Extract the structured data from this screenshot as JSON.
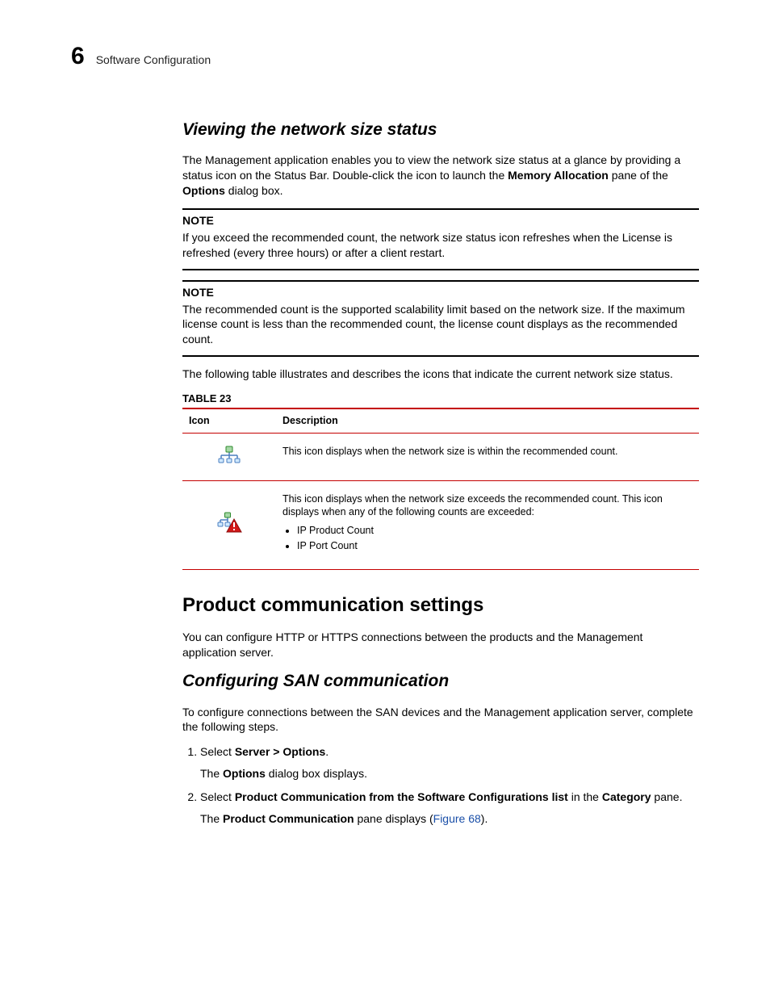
{
  "header": {
    "chapter_num": "6",
    "chapter_title": "Software Configuration"
  },
  "s1": {
    "heading": "Viewing the network size status",
    "para1_a": "The Management application enables you to view the network size status at a glance by providing a status icon on the Status Bar. Double-click the icon to launch the ",
    "para1_b": "Memory Allocation",
    "para1_c": " pane of the ",
    "para1_d": "Options",
    "para1_e": " dialog box.",
    "note1_label": "NOTE",
    "note1_body": "If you exceed the recommended count, the network size status icon refreshes when the License is refreshed (every three hours) or after a client restart.",
    "note2_label": "NOTE",
    "note2_body": "The recommended count is the supported scalability limit based on the network size. If the maximum license count is less than the recommended count, the license count displays as the recommended count.",
    "after_notes": "The following table illustrates and describes the icons that indicate the current network size status.",
    "table_label": "TABLE 23",
    "th_icon": "Icon",
    "th_desc": "Description",
    "row1_desc": "This icon displays when the network size is within the recommended count.",
    "row2_desc": "This icon displays when the network size exceeds the recommended count. This icon displays when any of the following counts are exceeded:",
    "row2_li1": "IP Product Count",
    "row2_li2": "IP Port Count"
  },
  "s2": {
    "heading": "Product communication settings",
    "intro": "You can configure HTTP or HTTPS connections between the products and the Management application server."
  },
  "s3": {
    "heading": "Configuring SAN communication",
    "intro": "To configure connections between the SAN devices and the Management application server, complete the following steps.",
    "step1_lead": "Select ",
    "step1_bold": "Server > Options",
    "step1_tail": ".",
    "step1_sub_a": "The ",
    "step1_sub_b": "Options",
    "step1_sub_c": " dialog box displays.",
    "step2_lead": "Select ",
    "step2_bold": "Product Communication from the Software Configurations list",
    "step2_mid": " in the ",
    "step2_bold2": "Category",
    "step2_tail": " pane.",
    "step2_sub_a": "The ",
    "step2_sub_b": "Product Communication",
    "step2_sub_c": " pane displays (",
    "step2_link": "Figure 68",
    "step2_sub_d": ")."
  }
}
